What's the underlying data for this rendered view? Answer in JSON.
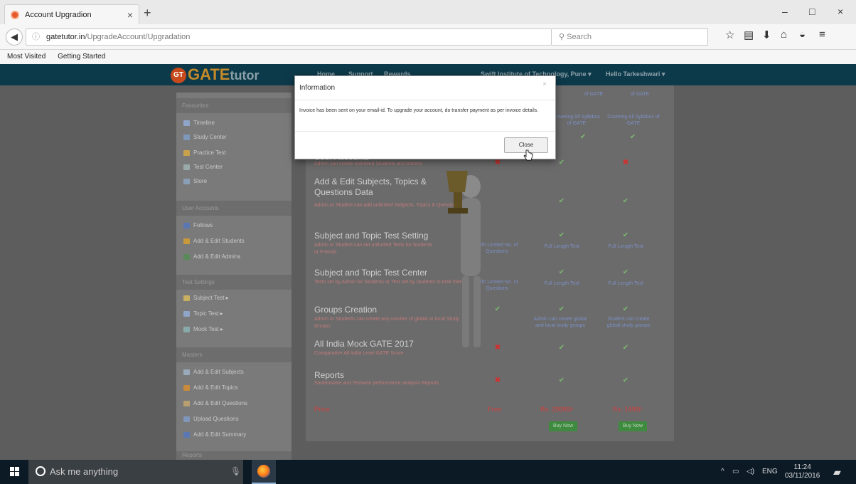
{
  "browser": {
    "tab_title": "Account Upgradion",
    "tab_close": "×",
    "new_tab": "+",
    "url_domain": "gatetutor.in",
    "url_path": "/UpgradeAccount/Upgradation",
    "search_placeholder": "Search",
    "bookmarks": [
      "Most Visited",
      "Getting Started"
    ],
    "win_controls": [
      "–",
      "□",
      "×"
    ]
  },
  "site": {
    "logo_main": "GATE",
    "logo_sub": "tutor",
    "logo_badge": "GT",
    "nav": [
      "Home",
      "Support",
      "Rewards",
      "Swift Institute of Technology, Pune ▾",
      "Hello Tarkeshwari ▾"
    ]
  },
  "sidebar": {
    "sections": [
      {
        "title": "Favourites",
        "items": [
          "Timeline",
          "Study Center",
          "Practice Test",
          "Test Center",
          "Store"
        ]
      },
      {
        "title": "User Accounts",
        "items": [
          "Follows",
          "Add & Edit Students",
          "Add & Edit Admins"
        ]
      },
      {
        "title": "Test Settings",
        "items": [
          "Subject Test ▸",
          "Topic Test ▸",
          "Mock Test ▸"
        ]
      },
      {
        "title": "Masters",
        "items": [
          "Add & Edit Subjects",
          "Add & Edit Topics",
          "Add & Edit Questions",
          "Upload Questions",
          "Add & Edit Summary"
        ]
      },
      {
        "title": "Reports",
        "items": []
      }
    ]
  },
  "table": {
    "header_cells": [
      "of GATE",
      "of GATE"
    ],
    "syllabus_cells": [
      "Covering All Syllabus of GATE",
      "Covering All Syllabus of GATE"
    ],
    "rows": [
      {
        "title": "User Accounts",
        "desc": "Admin can create unlimited Students and Admins",
        "c1": "✖",
        "c2": "✔",
        "c3": "✖"
      },
      {
        "title": "Add & Edit Subjects, Topics & Questions Data",
        "desc": "Admin or Student can add unlimited Subjects, Topics & Questions",
        "c1": "",
        "c2": "✔",
        "c3": "✔"
      },
      {
        "title": "Subject and Topic Test Setting",
        "desc": "Admin or Student can set unlimited Tests for Students or Friends",
        "c1": "With Limited No. of Questions",
        "c2": "Full Length Test",
        "c3": "Full Length Test"
      },
      {
        "title": "Subject and Topic Test Center",
        "desc": "Tests set by Admin for Students or Test set by students to their friends",
        "c1": "With Limited No. of Questions",
        "c2": "Full Length Test",
        "c3": "Full Length Test"
      },
      {
        "title": "Groups Creation",
        "desc": "Admin or Students can create any number of global or local Study Groups",
        "c1": "✔",
        "c2": "Admin can create global and local study groups",
        "c3": "Student can create global study groups"
      },
      {
        "title": "All India Mock GATE 2017",
        "desc": "Comparative All India Level GATE Score",
        "c1": "✖",
        "c2": "✔",
        "c3": "✔"
      },
      {
        "title": "Reports",
        "desc": "Studentwise and Testwise performance analysis Reports",
        "c1": "✖",
        "c2": "✔",
        "c3": "✔"
      }
    ],
    "price_label": "Price",
    "prices": [
      "Free",
      "Rs. 25000/-",
      "Rs. 1499/-"
    ],
    "buy_label": "Buy Now"
  },
  "modal": {
    "title": "Information",
    "close_x": "×",
    "message": "Invoice has been sent on your email-id. To upgrade your account, do transfer payment as per invoice details.",
    "close_button": "Close"
  },
  "taskbar": {
    "search_text": "Ask me anything",
    "lang": "ENG",
    "time": "11:24",
    "date": "03/11/2016"
  }
}
